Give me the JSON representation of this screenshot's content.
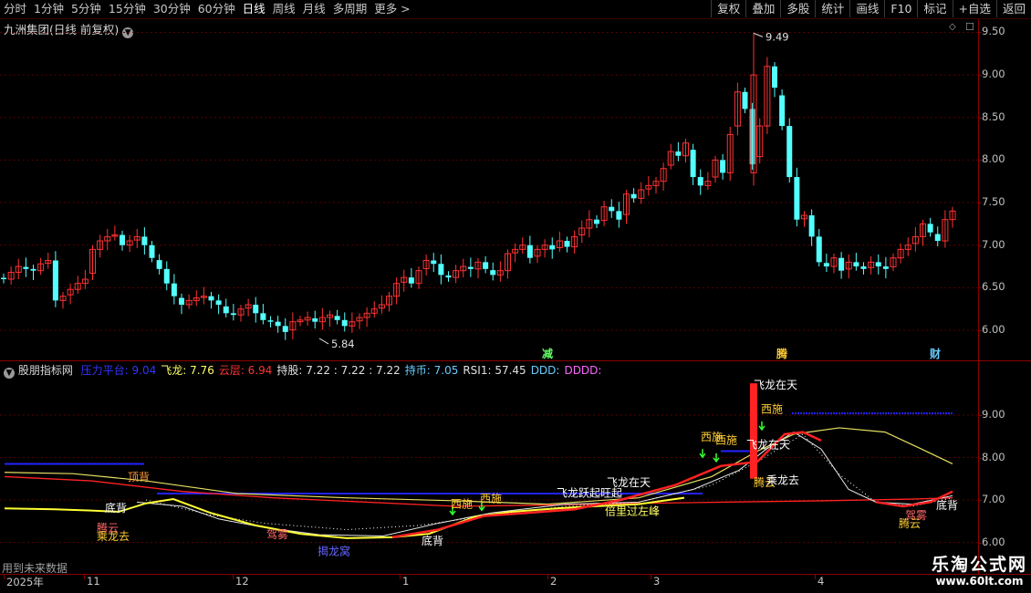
{
  "toolbar": {
    "periods": [
      "分时",
      "1分钟",
      "5分钟",
      "15分钟",
      "30分钟",
      "60分钟",
      "日线",
      "周线",
      "月线",
      "多周期",
      "更多 >"
    ],
    "active": "日线",
    "buttons": [
      "复权",
      "叠加",
      "多股",
      "统计",
      "画线",
      "F10",
      "标记",
      "+自选",
      "返回"
    ]
  },
  "main_chart": {
    "title": "九洲集团(日线 前复权)",
    "y_ticks": [
      "9.50",
      "9.00",
      "8.50",
      "8.00",
      "7.50",
      "7.00",
      "6.50",
      "6.00"
    ],
    "high_label": "9.49",
    "low_label": "5.84",
    "markers": [
      "减",
      "腾",
      "财"
    ]
  },
  "indicator": {
    "name": "股朋指标网",
    "fields": [
      {
        "text": "压力平台: 9.04",
        "color": "#3333ff"
      },
      {
        "text": "飞龙: 7.76",
        "color": "#ffff66"
      },
      {
        "text": "云层: 6.94",
        "color": "#ff3333"
      },
      {
        "text": "持股: 7.22 : 7.22 : 7.22",
        "color": "#e0e0e0"
      },
      {
        "text": "持币: 7.05",
        "color": "#66ccff"
      },
      {
        "text": "RSI1: 57.45",
        "color": "#e0e0e0"
      },
      {
        "text": "DDD:",
        "color": "#66ccff"
      },
      {
        "text": "DDDD:",
        "color": "#ff66ff"
      }
    ],
    "y_ticks": [
      "9.00",
      "8.00",
      "7.00",
      "6.00"
    ],
    "labels": [
      "顶背",
      "底背",
      "腾云",
      "乘龙去",
      "驾雾",
      "揭龙窝",
      "底背",
      "西施",
      "西施",
      "飞龙跃起旺起",
      "飞龙在天",
      "倍里过左峰",
      "西施",
      "西施",
      "飞龙在天",
      "飞龙在天",
      "腾云",
      "乘龙去",
      "西施",
      "驾雾",
      "腾云",
      "底背"
    ]
  },
  "footer": {
    "future_text": "用到未来数据",
    "x_labels": [
      "2025年",
      "11",
      "12",
      "1",
      "2",
      "3",
      "4"
    ]
  },
  "watermark": {
    "title": "乐淘公式网",
    "url": "www.60lt.com"
  },
  "colors": {
    "up": "#ff3232",
    "down": "#54ffff",
    "frame": "#8a0000",
    "bg": "#000000"
  }
}
